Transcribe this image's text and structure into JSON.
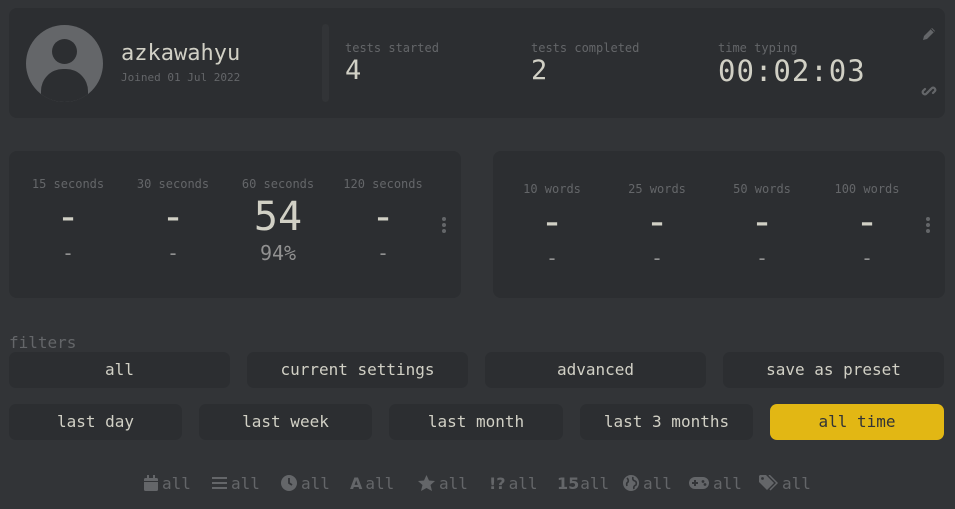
{
  "profile": {
    "username": "azkawahyu",
    "joined": "Joined 01 Jul 2022",
    "stats": [
      {
        "label": "tests started",
        "value": "4"
      },
      {
        "label": "tests completed",
        "value": "2"
      },
      {
        "label": "time typing",
        "value": "00:02:03"
      }
    ],
    "icons": [
      "pencil-icon",
      "link-icon"
    ]
  },
  "pb_time": [
    {
      "label": "15 seconds",
      "wpm": "-",
      "acc": "-"
    },
    {
      "label": "30 seconds",
      "wpm": "-",
      "acc": "-"
    },
    {
      "label": "60 seconds",
      "wpm": "54",
      "acc": "94%"
    },
    {
      "label": "120 seconds",
      "wpm": "-",
      "acc": "-"
    }
  ],
  "pb_words": [
    {
      "label": "10 words",
      "wpm": "-",
      "acc": "-"
    },
    {
      "label": "25 words",
      "wpm": "-",
      "acc": "-"
    },
    {
      "label": "50 words",
      "wpm": "-",
      "acc": "-"
    },
    {
      "label": "100 words",
      "wpm": "-",
      "acc": "-"
    }
  ],
  "filters": {
    "title": "filters",
    "presets": [
      "all",
      "current settings",
      "advanced",
      "save as preset"
    ],
    "time_ranges": [
      "last day",
      "last week",
      "last month",
      "last 3 months",
      "all time"
    ],
    "active_time_range": "all time",
    "bottom": [
      {
        "icon": "calendar-icon",
        "text": "all"
      },
      {
        "icon": "bars-icon",
        "text": "all"
      },
      {
        "icon": "clock-icon",
        "text": "all"
      },
      {
        "icon": "font-icon",
        "glyph": "A",
        "text": "all"
      },
      {
        "icon": "star-icon",
        "text": "all"
      },
      {
        "icon": "punctuation-icon",
        "glyph": "!?",
        "text": "all"
      },
      {
        "icon": "numbers-icon",
        "glyph": "15",
        "text": "all"
      },
      {
        "icon": "globe-icon",
        "text": "all"
      },
      {
        "icon": "gamepad-icon",
        "text": "all"
      },
      {
        "icon": "tag-icon",
        "text": "all"
      }
    ]
  },
  "colors": {
    "accent": "#e2b714",
    "background": "#323437",
    "card": "#2c2e31",
    "sub": "#646669",
    "text": "#d1d0c5"
  }
}
